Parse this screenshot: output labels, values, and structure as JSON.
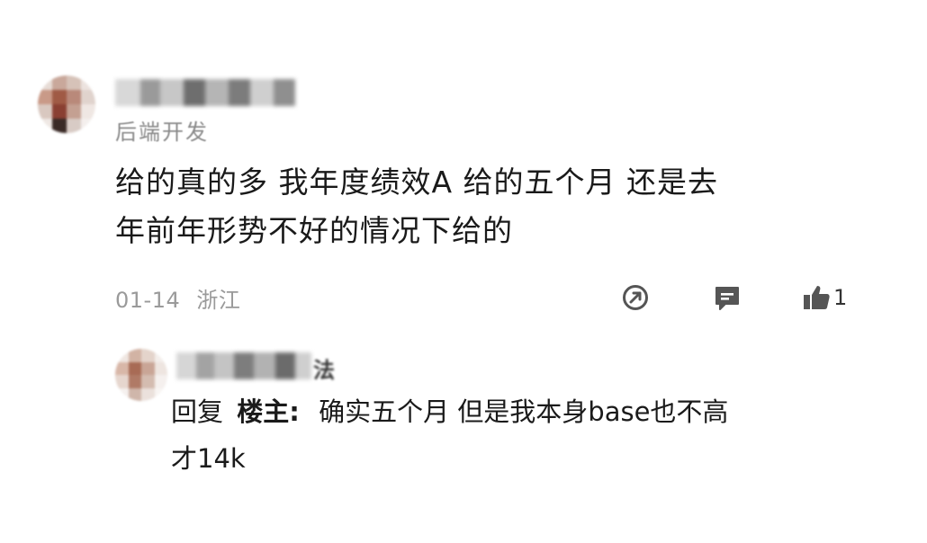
{
  "comment": {
    "author_title": "后端开发",
    "text_line1": "给的真的多 我年度绩效A 给的五个月 还是去",
    "text_line2": "年前年形势不好的情况下给的",
    "date": "01-14",
    "location": "浙江",
    "like_count": "1",
    "icons": [
      "share-icon",
      "comment-icon",
      "like-icon"
    ]
  },
  "reply": {
    "name_fragment": "法",
    "prefix": "回复",
    "op_label": "楼主:",
    "text_line1": "确实五个月 但是我本身base也不高",
    "text_line2": "才14k"
  },
  "colors": {
    "text": "#1a1a1a",
    "meta": "#9a9a9a",
    "icon": "#555555"
  }
}
